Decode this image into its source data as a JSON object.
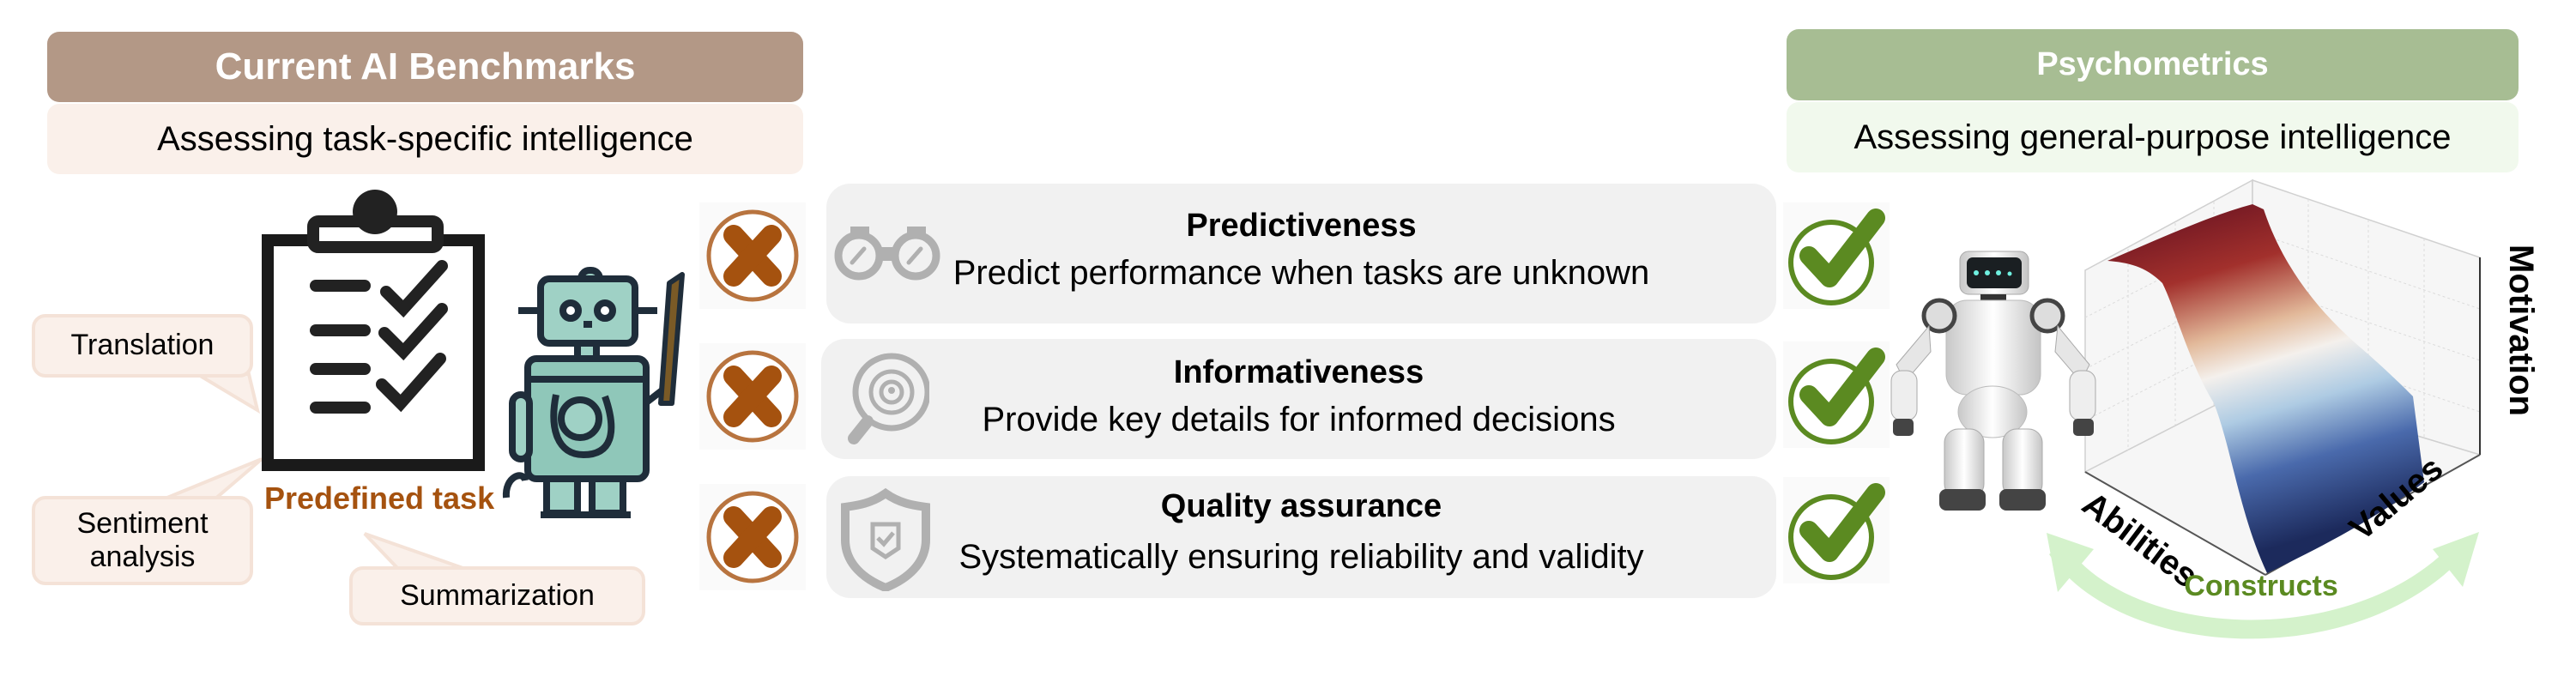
{
  "left_panel": {
    "title": "Current AI Benchmarks",
    "subtitle": "Assessing task-specific intelligence",
    "title_color": "#b39886",
    "subtitle_bg": "#faf0ea",
    "illustration_label": "Predefined task",
    "label_color": "#a5520f",
    "tasks": [
      "Translation",
      "Sentiment analysis",
      "Summarization"
    ]
  },
  "right_panel": {
    "title": "Psychometrics",
    "subtitle": "Assessing general-purpose intelligence",
    "title_color": "#a7bd93",
    "subtitle_bg": "#f1f9ed",
    "surface_axes": {
      "x": "Abilities",
      "y": "Values",
      "z": "Motivation"
    },
    "constructs_label": "Constructs",
    "constructs_color": "#5b8a21"
  },
  "criteria": [
    {
      "title": "Predictiveness",
      "description": "Predict performance when tasks are unknown",
      "icon": "binoculars-icon",
      "benchmarks_status": "fail",
      "psychometrics_status": "pass"
    },
    {
      "title": "Informativeness",
      "description": "Provide key details for informed decisions",
      "icon": "magnifier-target-icon",
      "benchmarks_status": "fail",
      "psychometrics_status": "pass"
    },
    {
      "title": "Quality assurance",
      "description": "Systematically ensuring reliability and validity",
      "icon": "shield-check-icon",
      "benchmarks_status": "fail",
      "psychometrics_status": "pass"
    }
  ],
  "colors": {
    "fail": "#a5520f",
    "pass": "#5b8a21",
    "row_bg": "#f1f1f1",
    "icon_gray": "#b3b3b3",
    "arrow": "#d4f2cb"
  }
}
